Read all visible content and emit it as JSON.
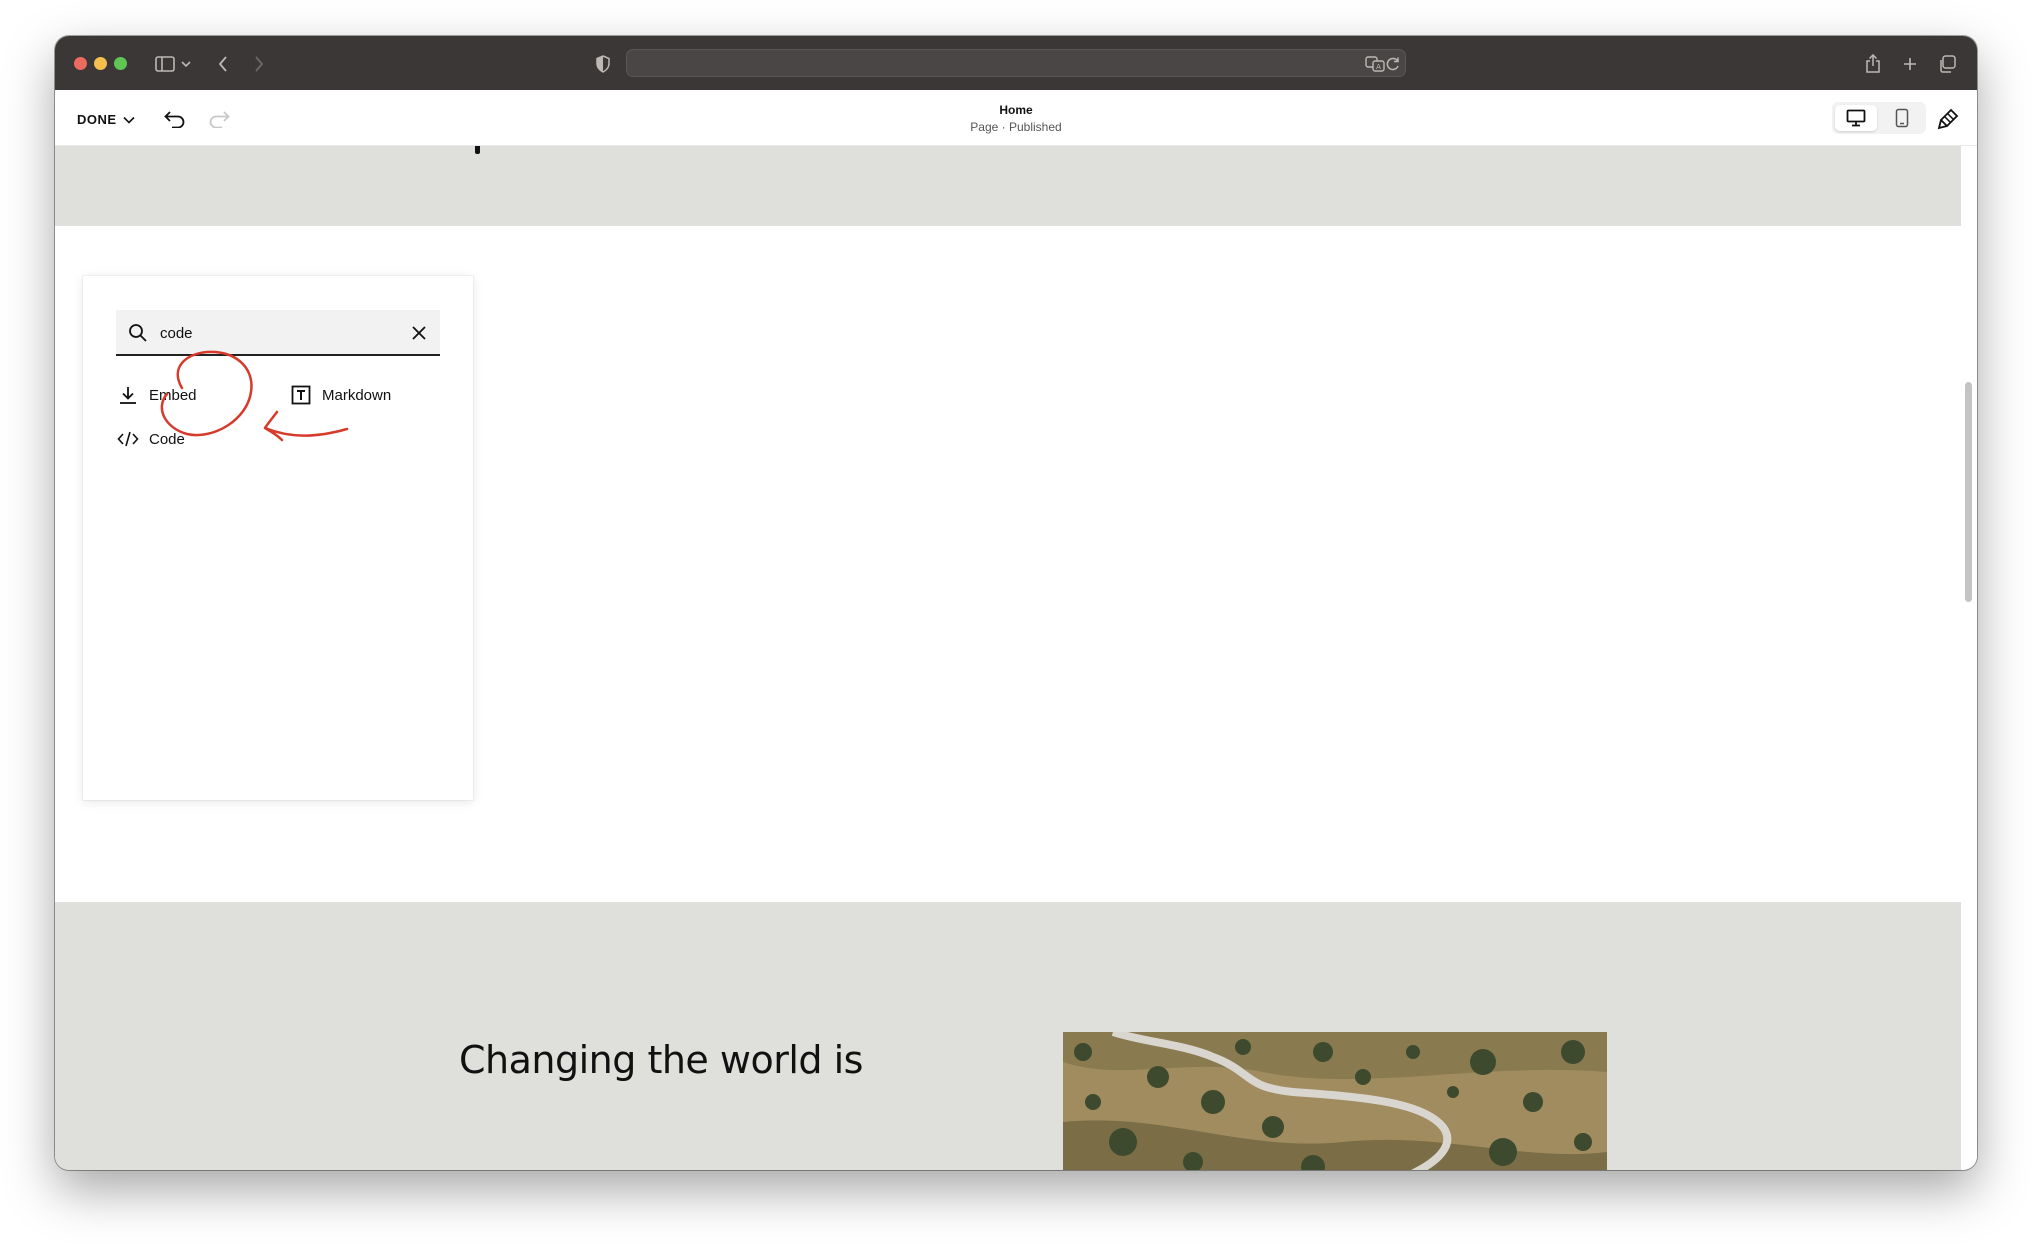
{
  "editor": {
    "done_label": "DONE",
    "page_title": "Home",
    "page_status": "Page · Published"
  },
  "block_picker": {
    "search": {
      "value": "code",
      "placeholder": ""
    },
    "results": [
      {
        "label": "Embed",
        "icon": "download-icon"
      },
      {
        "label": "Markdown",
        "icon": "markdown-icon"
      },
      {
        "label": "Code",
        "icon": "code-icon"
      }
    ]
  },
  "page": {
    "headline": "Changing the world is"
  },
  "colors": {
    "chrome_bg": "#3b3736",
    "section_bg": "#dfe0db",
    "annotation": "#d63a2a"
  }
}
